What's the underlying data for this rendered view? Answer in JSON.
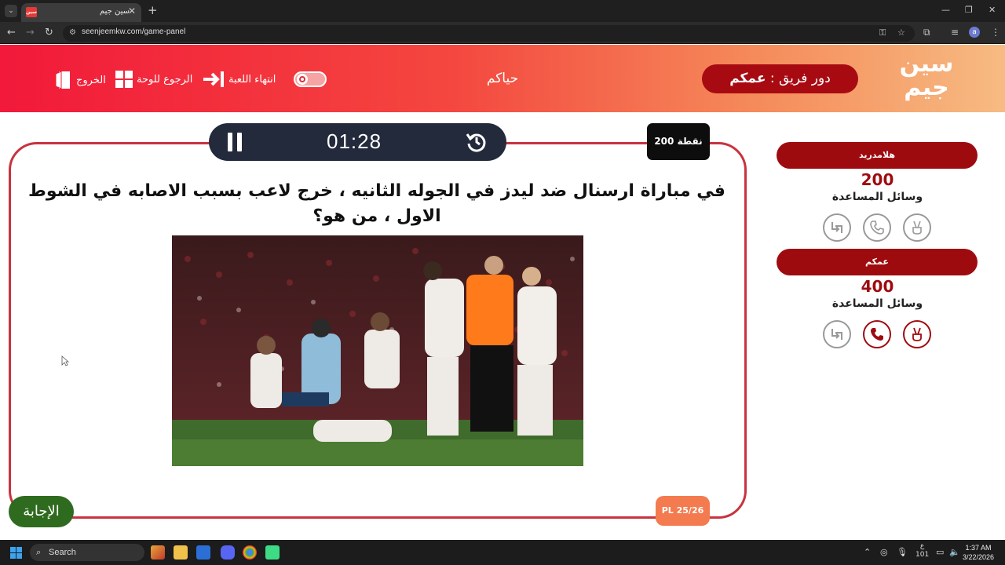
{
  "browser": {
    "tab_title": "سين جيم",
    "tab_close": "✕",
    "new_tab": "+",
    "url": "seenjeemkw.com/game-panel",
    "profile_initial": "a",
    "favicon_text": "سين"
  },
  "header": {
    "logo_line1": "سين",
    "logo_line2": "جيم",
    "turn_prefix": "دور فريق :",
    "turn_team": "عمكم",
    "welcome": "حياكم",
    "end_game": "انتهاء اللعبة",
    "back_to_board": "الرجوع للوحة",
    "exit": "الخروج"
  },
  "teams": [
    {
      "name": "هلامدريد",
      "score": "200",
      "aids_label": "وسائل المساعدة",
      "aids_active": [
        false,
        false,
        false
      ]
    },
    {
      "name": "عمكم",
      "score": "400",
      "aids_label": "وسائل المساعدة",
      "aids_active": [
        true,
        true,
        false
      ]
    }
  ],
  "timer": {
    "time": "01:28"
  },
  "points_badge": "200 نقطة",
  "question": "في مباراة ارسنال ضد ليدز في الجوله الثانيه ، خرج لاعب بسبب الاصابه في الشوط الاول ، من هو؟",
  "answer_button": "الإجابة",
  "category_tag": "PL 25/26",
  "taskbar": {
    "search_placeholder": "Search",
    "time": "1:37 AM",
    "date": "3/22/2026",
    "lang": "ع",
    "lang_sub": "101"
  },
  "colors": {
    "accent": "#9e0b0f",
    "card_border": "#c8333f",
    "answer_green": "#2e6b1f",
    "tag_orange": "#f47b50",
    "timer_bg": "#222a3b"
  }
}
